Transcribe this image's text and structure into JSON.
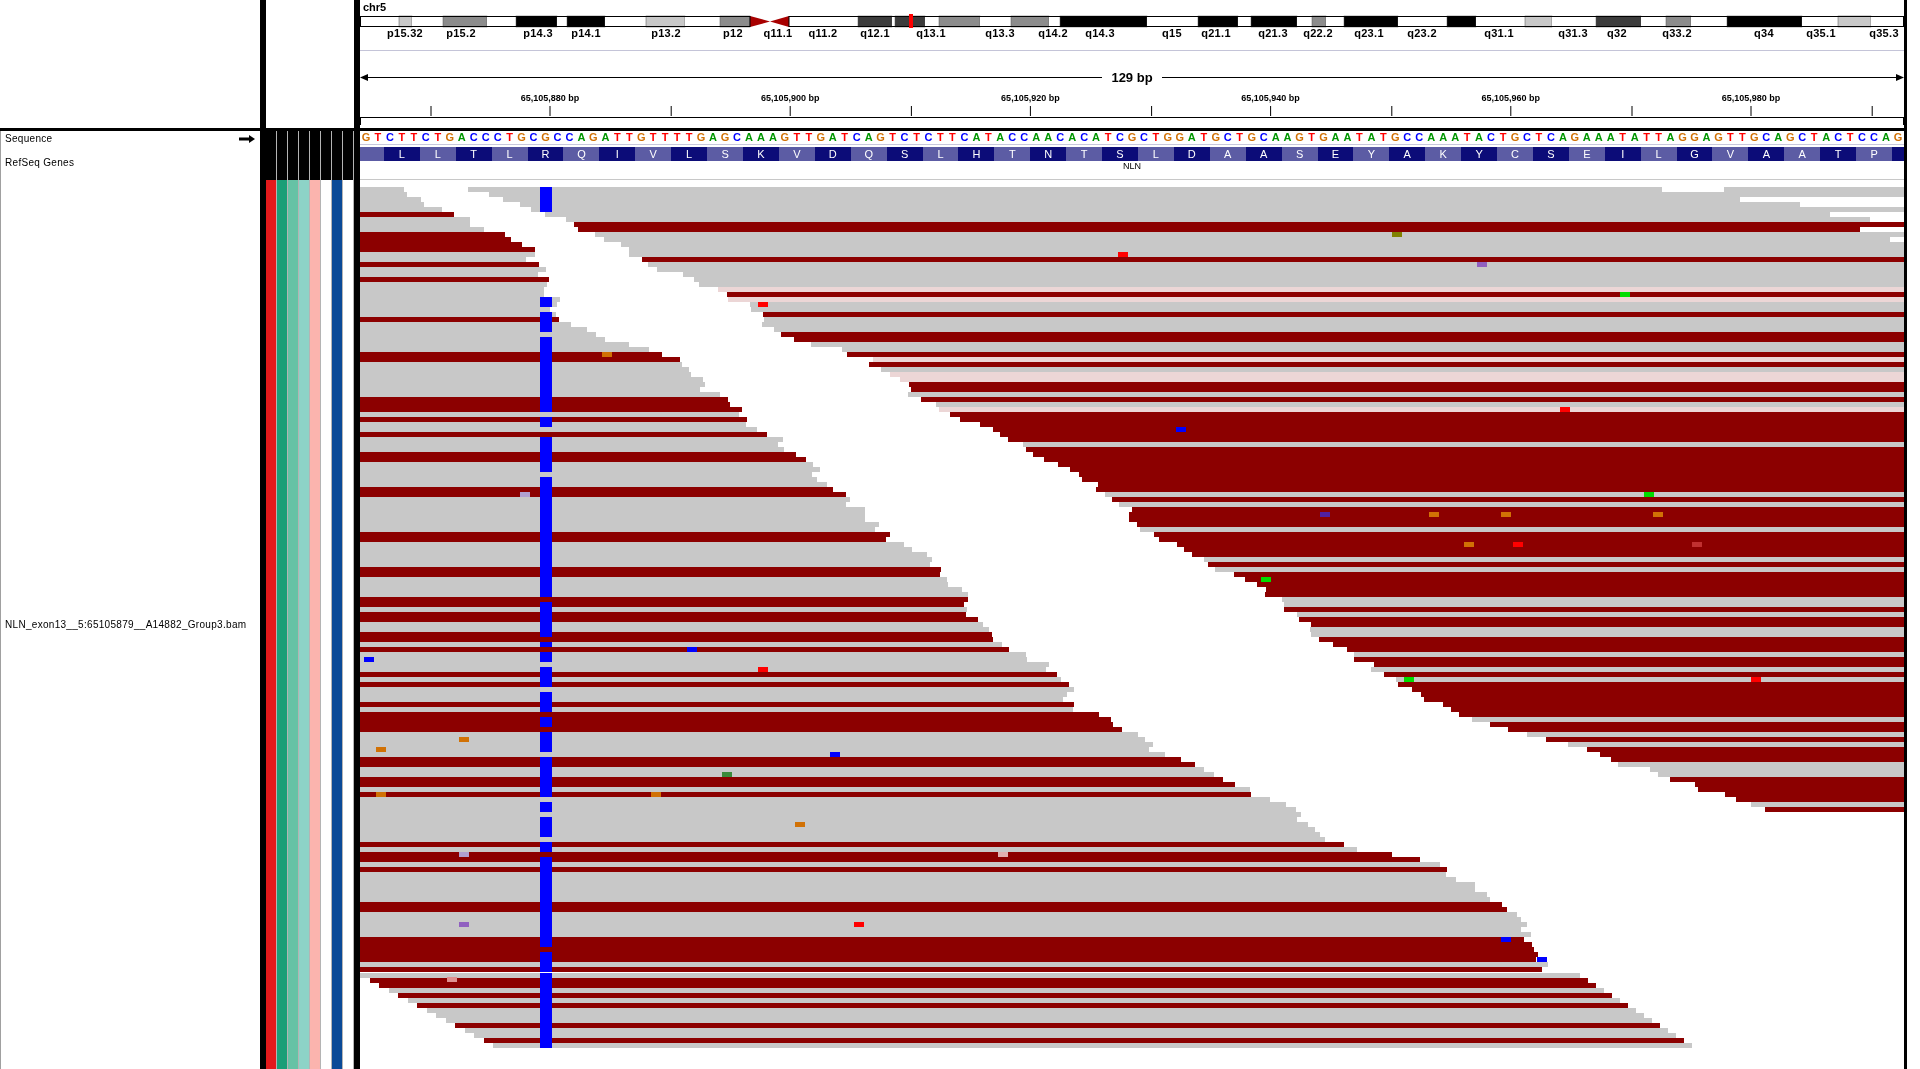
{
  "genome_view": {
    "chromosome": "chr5",
    "band_labels": [
      "p15.32",
      "p15.2",
      "p14.3",
      "p14.1",
      "p13.2",
      "p12",
      "q11.1",
      "q11.2",
      "q12.1",
      "q13.1",
      "q13.3",
      "q14.2",
      "q14.3",
      "q15",
      "q21.1",
      "q21.3",
      "q22.2",
      "q23.1",
      "q23.2",
      "q31.1",
      "q31.3",
      "q32",
      "q33.2",
      "q34",
      "q35.1",
      "q35.3"
    ],
    "ruler": {
      "span": "129 bp",
      "tick_labels": [
        "65,105,880 bp",
        "65,105,900 bp",
        "65,105,920 bp",
        "65,105,940 bp",
        "65,105,960 bp",
        "65,105,980 bp"
      ]
    }
  },
  "tracks": [
    {
      "kind": "sequence",
      "name": "Sequence",
      "forward_strand": true,
      "bases": [
        "G",
        "T",
        "C",
        "T",
        "T",
        "C",
        "T",
        "G",
        "A",
        "C",
        "C",
        "C",
        "T",
        "G",
        "C",
        "G",
        "C",
        "C",
        "A",
        "G",
        "A",
        "T",
        "T",
        "G",
        "T",
        "T",
        "T",
        "T",
        "G",
        "A",
        "G",
        "C",
        "A",
        "A",
        "A",
        "G",
        "T",
        "T",
        "G",
        "A",
        "T",
        "C",
        "A",
        "G",
        "T",
        "C",
        "T",
        "C",
        "T",
        "T",
        "C",
        "A",
        "T",
        "A",
        "C",
        "C",
        "A",
        "A",
        "C",
        "A",
        "C",
        "A",
        "T",
        "C",
        "G",
        "C",
        "T",
        "G",
        "G",
        "A",
        "T",
        "G",
        "C",
        "T",
        "G",
        "C",
        "A",
        "A",
        "G",
        "T",
        "G",
        "A",
        "A",
        "T",
        "A",
        "T",
        "G",
        "C",
        "C",
        "A",
        "A",
        "A",
        "T",
        "A",
        "C",
        "T",
        "G",
        "C",
        "T",
        "C",
        "A",
        "G",
        "A",
        "A",
        "A",
        "T",
        "A",
        "T",
        "T",
        "A",
        "G",
        "G",
        "A",
        "G",
        "T",
        "T",
        "G",
        "C",
        "A",
        "G",
        "C",
        "T",
        "A",
        "C",
        "T",
        "C",
        "C",
        "A",
        "G"
      ]
    },
    {
      "kind": "gene",
      "name": "RefSeq Genes",
      "gene": "NLN",
      "amino_acids": [
        "L",
        "L",
        "T",
        "L",
        "R",
        "Q",
        "I",
        "V",
        "L",
        "S",
        "K",
        "V",
        "D",
        "Q",
        "S",
        "L",
        "H",
        "T",
        "N",
        "T",
        "S",
        "L",
        "D",
        "A",
        "A",
        "S",
        "E",
        "Y",
        "A",
        "K",
        "Y",
        "C",
        "S",
        "E",
        "I",
        "L",
        "G",
        "V",
        "A",
        "A",
        "T",
        "P"
      ]
    },
    {
      "kind": "alignment",
      "name": "NLN_exon13__5:65105879__A14882_Group3.bam",
      "attributes": [
        {
          "color": "#e31a1c"
        },
        {
          "color": "#1b9e77"
        },
        {
          "color": "#66c2a5"
        },
        {
          "color": "#8dd3c7"
        },
        {
          "color": "#fbb4ae"
        },
        {
          "color": "#ffffff"
        },
        {
          "color": "#0a4a97"
        },
        {
          "color": "#ffffff"
        }
      ]
    }
  ]
}
